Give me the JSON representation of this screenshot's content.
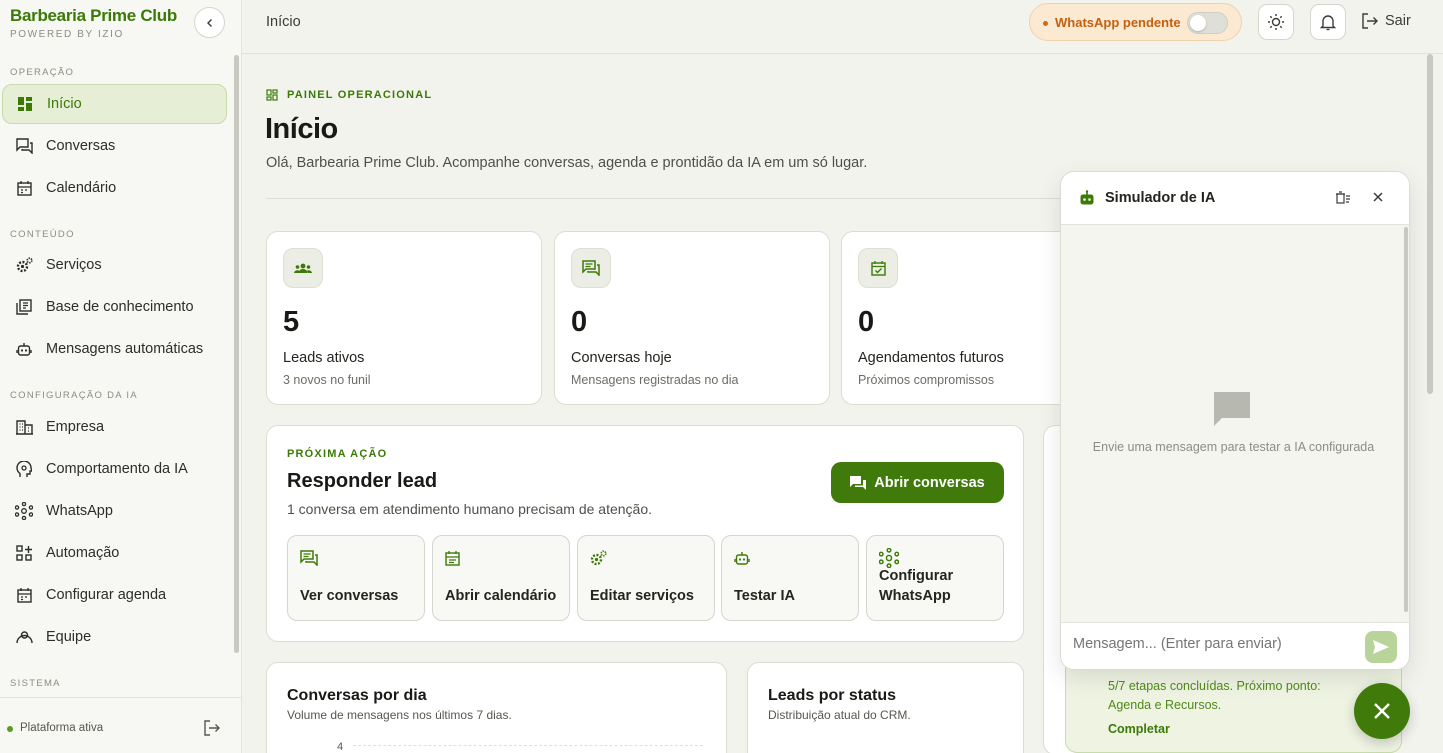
{
  "brand": {
    "name": "Barbearia Prime Club",
    "sub": "POWERED BY IZIO"
  },
  "sidebar": {
    "sections": [
      {
        "title": "OPERAÇÃO"
      },
      {
        "title": "CONTEÚDO"
      },
      {
        "title": "CONFIGURAÇÃO DA IA"
      },
      {
        "title": "SISTEMA"
      }
    ],
    "items": [
      {
        "label": "Início",
        "icon": "dashboard-icon"
      },
      {
        "label": "Conversas",
        "icon": "chat-icon"
      },
      {
        "label": "Calendário",
        "icon": "calendar-icon"
      },
      {
        "label": "Serviços",
        "icon": "gears-icon"
      },
      {
        "label": "Base de conhecimento",
        "icon": "book-icon"
      },
      {
        "label": "Mensagens automáticas",
        "icon": "robot-icon"
      },
      {
        "label": "Empresa",
        "icon": "building-icon"
      },
      {
        "label": "Comportamento da IA",
        "icon": "head-icon"
      },
      {
        "label": "WhatsApp",
        "icon": "network-icon"
      },
      {
        "label": "Automação",
        "icon": "automation-icon"
      },
      {
        "label": "Configurar agenda",
        "icon": "calendar-icon"
      },
      {
        "label": "Equipe",
        "icon": "team-icon"
      }
    ],
    "footer_status": "Plataforma ativa"
  },
  "topbar": {
    "breadcrumb": "Início",
    "whatsapp_status": "WhatsApp pendente",
    "logout_label": "Sair"
  },
  "main": {
    "eyebrow": "PAINEL OPERACIONAL",
    "title": "Início",
    "subtitle": "Olá, Barbearia Prime Club. Acompanhe conversas, agenda e prontidão da IA em um só lugar.",
    "stats": [
      {
        "value": "5",
        "label": "Leads ativos",
        "hint": "3 novos no funil",
        "icon": "group-icon"
      },
      {
        "value": "0",
        "label": "Conversas hoje",
        "hint": "Mensagens registradas no dia",
        "icon": "chat-icon"
      },
      {
        "value": "0",
        "label": "Agendamentos futuros",
        "hint": "Próximos compromissos",
        "icon": "calendar-check-icon"
      }
    ],
    "next_action": {
      "eyebrow": "PRÓXIMA AÇÃO",
      "title": "Responder lead",
      "subtitle": "1 conversa em atendimento humano precisam de atenção.",
      "button": "Abrir conversas",
      "quick_actions": [
        {
          "label": "Ver conversas",
          "icon": "chat-icon"
        },
        {
          "label": "Abrir calendário",
          "icon": "calendar-icon"
        },
        {
          "label": "Editar serviços",
          "icon": "gears-icon"
        },
        {
          "label": "Testar IA",
          "icon": "robot-icon"
        },
        {
          "label": "Configurar WhatsApp",
          "icon": "network-icon"
        }
      ]
    },
    "charts": [
      {
        "title": "Conversas por dia",
        "subtitle": "Volume de mensagens nos últimos 7 dias.",
        "first_tick": "4"
      },
      {
        "title": "Leads por status",
        "subtitle": "Distribuição atual do CRM."
      }
    ],
    "onboarding": {
      "text": "5/7 etapas concluídas. Próximo ponto: Agenda e Recursos.",
      "link": "Completar"
    }
  },
  "simulator": {
    "title": "Simulador de IA",
    "empty": "Envie uma mensagem para testar a IA configurada",
    "placeholder": "Mensagem... (Enter para enviar)"
  },
  "colors": {
    "brand": "#3c7a08",
    "accent": "#3f7a0a",
    "warning": "#c46011"
  }
}
